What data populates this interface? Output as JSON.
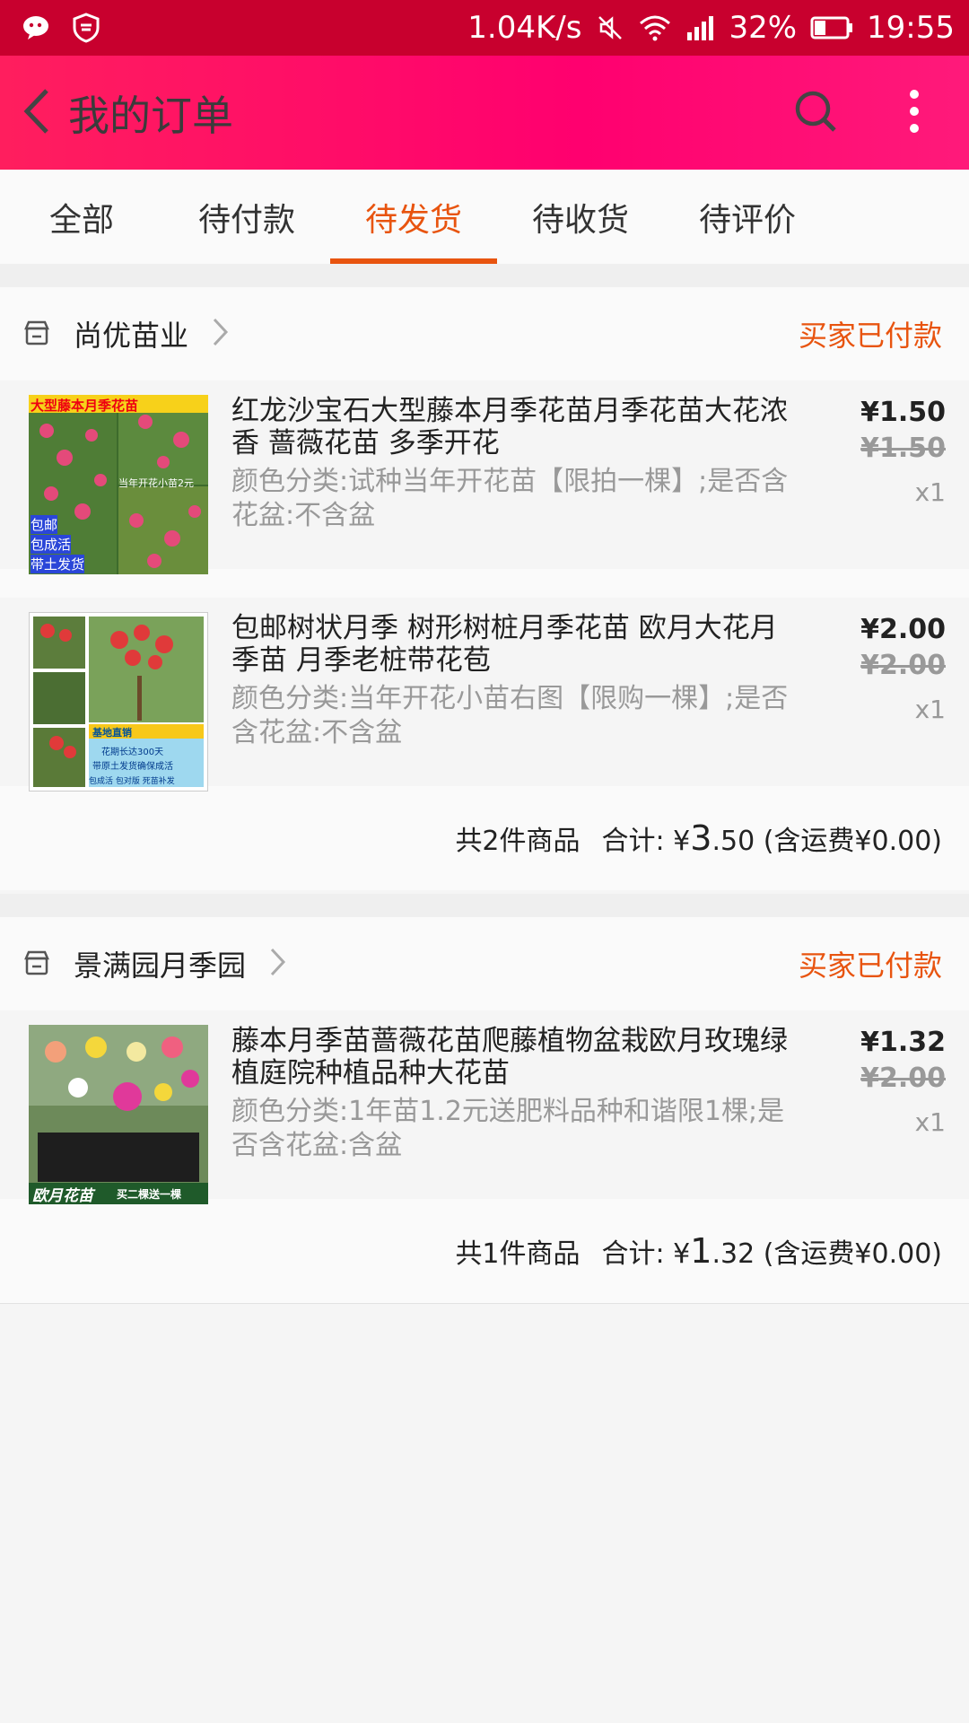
{
  "status_bar": {
    "speed": "1.04K/s",
    "battery": "32%",
    "time": "19:55",
    "icons": [
      "wechat-icon",
      "shield-icon",
      "mute-icon",
      "wifi-icon",
      "signal-icon",
      "battery-icon"
    ]
  },
  "header": {
    "title": "我的订单",
    "icons": [
      "back-icon",
      "search-icon",
      "more-icon"
    ]
  },
  "tabs": [
    {
      "label": "全部"
    },
    {
      "label": "待付款"
    },
    {
      "label": "待发货",
      "active": true
    },
    {
      "label": "待收货"
    },
    {
      "label": "待评价"
    }
  ],
  "orders": [
    {
      "shop": "尚优苗业",
      "status": "买家已付款",
      "items": [
        {
          "title": "红龙沙宝石大型藤本月季花苗月季花苗大花浓香 蔷薇花苗 多季开花",
          "spec": "颜色分类:试种当年开花苗【限拍一棵】;是否含花盆:不含盆",
          "price": "¥1.50",
          "original_price": "¥1.50",
          "qty": "x1",
          "thumb_text": [
            "大型藤本月季花苗",
            "当年开花小苗2元",
            "包邮",
            "包成活",
            "带土发货"
          ]
        },
        {
          "title": "包邮树状月季 树形树桩月季花苗 欧月大花月季苗 月季老桩带花苞",
          "spec": "颜色分类:当年开花小苗右图【限购一棵】;是否含花盆:不含盆",
          "price": "¥2.00",
          "original_price": "¥2.00",
          "qty": "x1",
          "thumb_text": [
            "基地直销",
            "花期长达300天",
            "带原土发货确保成活",
            "包成活 包对版 死苗补发"
          ]
        }
      ],
      "summary": {
        "count": "共2件商品",
        "label": "合计: ¥",
        "big": "3",
        "rest": ".50 (含运费¥0.00)"
      }
    },
    {
      "shop": "景满园月季园",
      "status": "买家已付款",
      "items": [
        {
          "title": "藤本月季苗蔷薇花苗爬藤植物盆栽欧月玫瑰绿植庭院种植品种大花苗",
          "spec": "颜色分类:1年苗1.2元送肥料品种和谐限1棵;是否含花盆:含盆",
          "price": "¥1.32",
          "original_price": "¥2.00",
          "qty": "x1",
          "thumb_text": [
            "欧月花苗",
            "买二棵送一棵"
          ]
        }
      ],
      "summary": {
        "count": "共1件商品",
        "label": "合计: ¥",
        "big": "1",
        "rest": ".32 (含运费¥0.00)"
      }
    }
  ],
  "colors": {
    "status_bar": "#c8002e",
    "header": "#ff006f",
    "accent": "#e8540f"
  }
}
